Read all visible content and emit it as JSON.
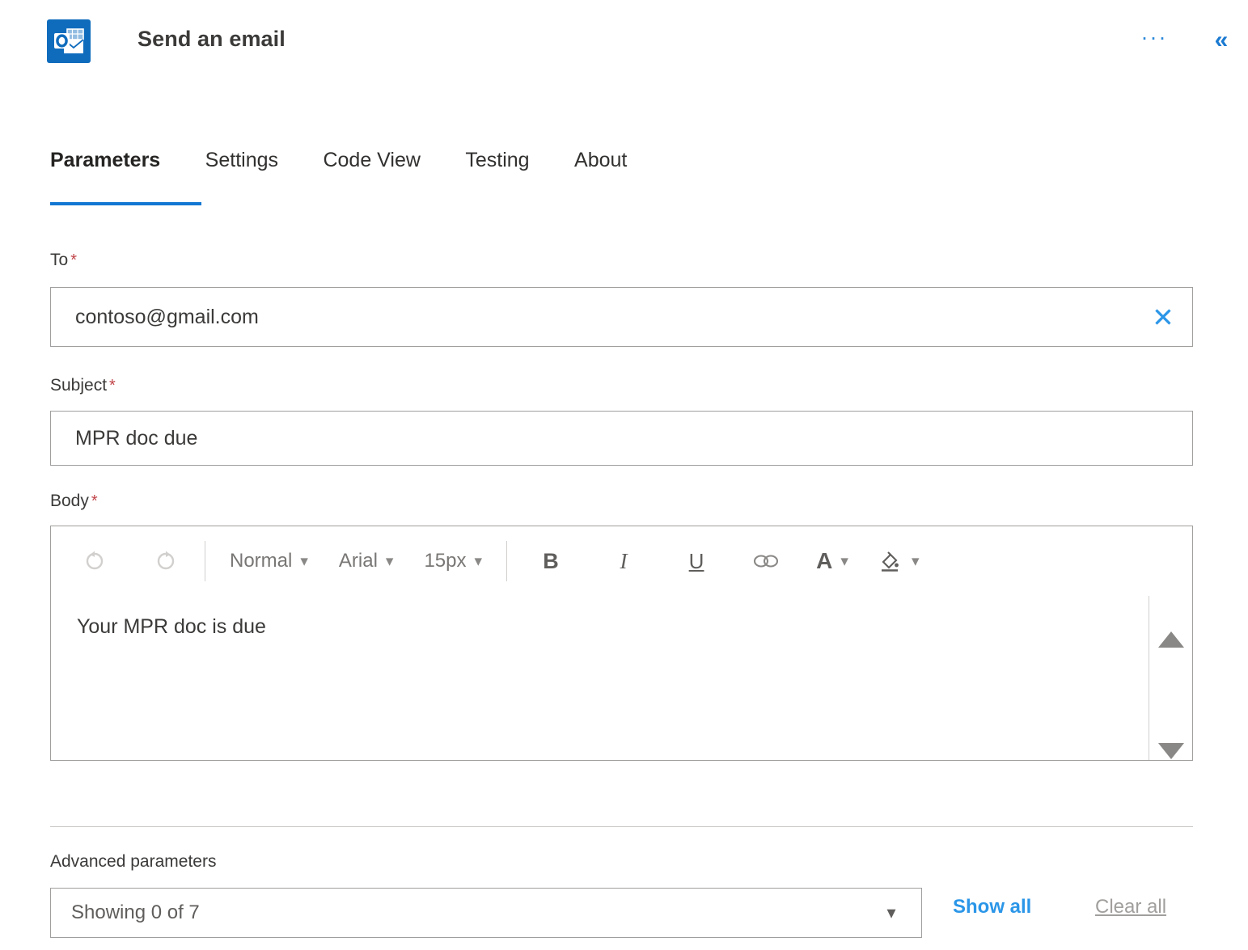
{
  "header": {
    "app_icon": "outlook-icon",
    "title": "Send an email",
    "more_label": "···",
    "collapse_label": "«",
    "accent_color": "#2b96e8",
    "icon_bg_color": "#0f6cbd"
  },
  "tabs": [
    {
      "label": "Parameters",
      "active": true
    },
    {
      "label": "Settings",
      "active": false
    },
    {
      "label": "Code View",
      "active": false
    },
    {
      "label": "Testing",
      "active": false
    },
    {
      "label": "About",
      "active": false
    }
  ],
  "tab_accent_color": "#1277d2",
  "fields": {
    "to": {
      "label": "To",
      "required_marker": "*",
      "value": "contoso@gmail.com",
      "clear_icon": "close-icon"
    },
    "subject": {
      "label": "Subject",
      "required_marker": "*",
      "value": "MPR doc due"
    },
    "body": {
      "label": "Body",
      "required_marker": "*",
      "value": "Your MPR doc is due"
    }
  },
  "required_color": "#c1454a",
  "rich_text_toolbar": {
    "undo": {
      "icon": "undo-icon",
      "glyph": "↺",
      "disabled": true
    },
    "redo": {
      "icon": "redo-icon",
      "glyph": "↻",
      "disabled": true
    },
    "style_select": {
      "value": "Normal",
      "chevron": "⌄"
    },
    "font_select": {
      "value": "Arial",
      "chevron": "⌄"
    },
    "size_select": {
      "value": "15px",
      "chevron": "⌄"
    },
    "bold": {
      "label": "B",
      "icon": "bold-icon"
    },
    "italic": {
      "label": "I",
      "icon": "italic-icon"
    },
    "underline": {
      "label": "U",
      "icon": "underline-icon"
    },
    "link": {
      "glyph": "∞",
      "icon": "link-icon"
    },
    "font_color": {
      "label": "A",
      "icon": "font-color-icon",
      "chevron": "⌄"
    },
    "highlight": {
      "icon": "highlight-icon",
      "chevron": "⌄"
    }
  },
  "body_scroll": {
    "up_icon": "scroll-up-arrow-icon",
    "down_icon": "scroll-down-arrow-icon"
  },
  "advanced": {
    "label": "Advanced parameters",
    "select_value": "Showing 0 of 7",
    "select_chevron": "⌄",
    "show_all": "Show all",
    "clear_all": "Clear all",
    "show_all_color": "#2b96e8",
    "clear_all_color": "#a19f9d"
  }
}
